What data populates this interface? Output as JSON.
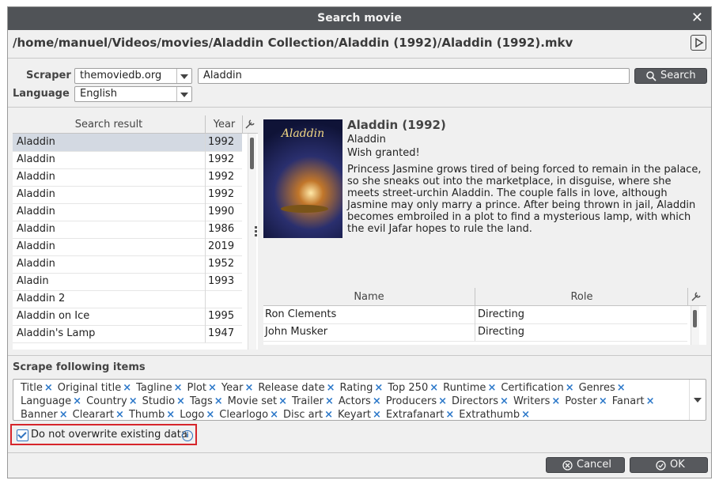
{
  "window": {
    "title": "Search movie"
  },
  "file_path": "/home/manuel/Videos/movies/Aladdin Collection/Aladdin (1992)/Aladdin (1992).mkv",
  "form": {
    "scraper_label": "Scraper",
    "scraper_value": "themoviedb.org",
    "language_label": "Language",
    "language_value": "English",
    "search_query": "Aladdin",
    "search_button": "Search"
  },
  "results": {
    "col_title": "Search result",
    "col_year": "Year",
    "rows": [
      {
        "title": "Aladdin",
        "year": "1992"
      },
      {
        "title": "Aladdin",
        "year": "1992"
      },
      {
        "title": "Aladdin",
        "year": "1992"
      },
      {
        "title": "Aladdin",
        "year": "1992"
      },
      {
        "title": "Aladdin",
        "year": "1990"
      },
      {
        "title": "Aladdin",
        "year": "1986"
      },
      {
        "title": "Aladdin",
        "year": "2019"
      },
      {
        "title": "Aladdin",
        "year": "1952"
      },
      {
        "title": "Aladin",
        "year": "1993"
      },
      {
        "title": "Aladdin 2",
        "year": ""
      },
      {
        "title": "Aladdin on Ice",
        "year": "1995"
      },
      {
        "title": "Aladdin's Lamp",
        "year": "1947"
      }
    ]
  },
  "detail": {
    "poster_text": "Aladdin",
    "title": "Aladdin (1992)",
    "original_title": "Aladdin",
    "tagline": "Wish granted!",
    "plot": "Princess Jasmine grows tired of being forced to remain in the palace, so she sneaks out into the marketplace, in disguise, where she meets street-urchin Aladdin.  The couple falls in love, although Jasmine may only marry a prince.  After being thrown in jail, Aladdin becomes embroiled in a plot to find a mysterious lamp, with which the evil Jafar hopes to rule the land."
  },
  "crew": {
    "col_name": "Name",
    "col_role": "Role",
    "rows": [
      {
        "name": "Ron Clements",
        "role": "Directing"
      },
      {
        "name": "John Musker",
        "role": "Directing"
      }
    ]
  },
  "scrape": {
    "label": "Scrape following items",
    "items": [
      "Title",
      "Original title",
      "Tagline",
      "Plot",
      "Year",
      "Release date",
      "Rating",
      "Top 250",
      "Runtime",
      "Certification",
      "Genres",
      "Language",
      "Country",
      "Studio",
      "Tags",
      "Movie set",
      "Trailer",
      "Actors",
      "Producers",
      "Directors",
      "Writers",
      "Poster",
      "Fanart",
      "Banner",
      "Clearart",
      "Thumb",
      "Logo",
      "Clearlogo",
      "Disc art",
      "Keyart",
      "Extrafanart",
      "Extrathumb"
    ],
    "remove_glyph": "×"
  },
  "overwrite": {
    "label": "Do not overwrite existing data",
    "checked": true
  },
  "buttons": {
    "cancel": "Cancel",
    "ok": "OK"
  },
  "colors": {
    "titlebar": "#505357",
    "accent": "#2c78c9",
    "highlight_box": "#d6252b",
    "selected_row": "#d3d9e2"
  }
}
